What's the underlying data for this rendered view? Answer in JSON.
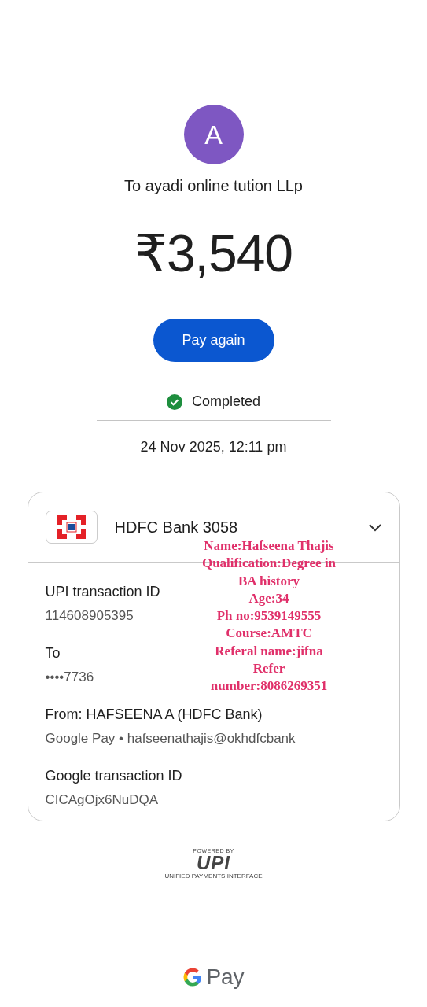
{
  "avatar": {
    "initial": "A"
  },
  "recipient": "To ayadi online tution LLp",
  "amount": "₹3,540",
  "pay_again_button": "Pay again",
  "status": {
    "label": "Completed",
    "kind": "completed"
  },
  "timestamp": "24 Nov 2025, 12:11 pm",
  "details_card": {
    "bank": "HDFC Bank 3058",
    "expanded": true,
    "fields": [
      {
        "label": "UPI transaction ID",
        "value": "114608905395"
      },
      {
        "label": "To",
        "value": "••••7736"
      },
      {
        "label": "From: HAFSEENA A (HDFC Bank)",
        "value": "Google Pay • hafseenathajis@okhdfcbank"
      },
      {
        "label": "Google transaction ID",
        "value": "CICAgOjx6NuDQA"
      }
    ]
  },
  "upi_logo": {
    "powered_by": "POWERED BY",
    "mark": "UPI",
    "tagline": "UNIFIED PAYMENTS INTERFACE"
  },
  "footer_logo": {
    "text": "Pay"
  },
  "annotation": {
    "lines": [
      "Name:Hafseena Thajis",
      "Qualification:Degree in",
      "BA history",
      "Age:34",
      "Ph no:9539149555",
      "Course:AMTC",
      "Referal name:jifna",
      "Refer",
      "number:8086269351"
    ]
  }
}
